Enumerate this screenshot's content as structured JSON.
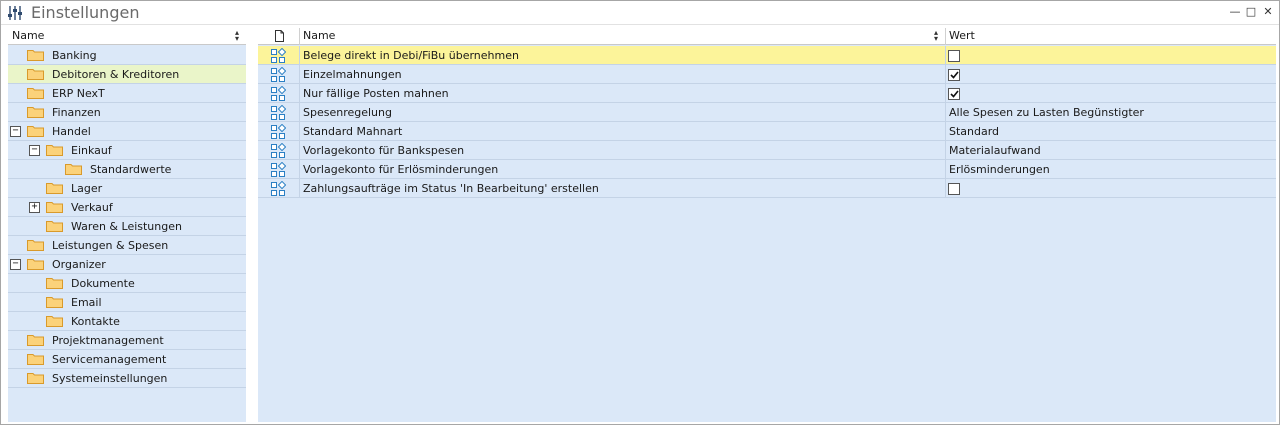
{
  "window": {
    "title": "Einstellungen",
    "icon": "sliders-icon",
    "controls": {
      "minimize": "—",
      "maximize": "□",
      "close": "✕"
    }
  },
  "tree": {
    "header": "Name",
    "items": [
      {
        "label": "Banking",
        "level": 0,
        "expander": "",
        "selected": false
      },
      {
        "label": "Debitoren & Kreditoren",
        "level": 0,
        "expander": "",
        "selected": true
      },
      {
        "label": "ERP NexT",
        "level": 0,
        "expander": "",
        "selected": false
      },
      {
        "label": "Finanzen",
        "level": 0,
        "expander": "",
        "selected": false
      },
      {
        "label": "Handel",
        "level": 0,
        "expander": "minus",
        "selected": false
      },
      {
        "label": "Einkauf",
        "level": 1,
        "expander": "minus",
        "selected": false
      },
      {
        "label": "Standardwerte",
        "level": 2,
        "expander": "",
        "selected": false
      },
      {
        "label": "Lager",
        "level": 1,
        "expander": "",
        "selected": false
      },
      {
        "label": "Verkauf",
        "level": 1,
        "expander": "plus",
        "selected": false
      },
      {
        "label": "Waren & Leistungen",
        "level": 1,
        "expander": "",
        "selected": false
      },
      {
        "label": "Leistungen & Spesen",
        "level": 0,
        "expander": "",
        "selected": false
      },
      {
        "label": "Organizer",
        "level": 0,
        "expander": "minus",
        "selected": false
      },
      {
        "label": "Dokumente",
        "level": 1,
        "expander": "",
        "selected": false
      },
      {
        "label": "Email",
        "level": 1,
        "expander": "",
        "selected": false
      },
      {
        "label": "Kontakte",
        "level": 1,
        "expander": "",
        "selected": false
      },
      {
        "label": "Projektmanagement",
        "level": 0,
        "expander": "",
        "selected": false
      },
      {
        "label": "Servicemanagement",
        "level": 0,
        "expander": "",
        "selected": false
      },
      {
        "label": "Systemeinstellungen",
        "level": 0,
        "expander": "",
        "selected": false
      }
    ]
  },
  "grid": {
    "columns": {
      "icon": "document-icon",
      "name": "Name",
      "value": "Wert"
    },
    "rows": [
      {
        "name": "Belege direkt in Debi/FiBu übernehmen",
        "type": "checkbox",
        "checked": false,
        "selected": true
      },
      {
        "name": "Einzelmahnungen",
        "type": "checkbox",
        "checked": true,
        "selected": false
      },
      {
        "name": "Nur fällige Posten mahnen",
        "type": "checkbox",
        "checked": true,
        "selected": false
      },
      {
        "name": "Spesenregelung",
        "type": "text",
        "value": "Alle Spesen zu Lasten Begünstigter",
        "selected": false
      },
      {
        "name": "Standard Mahnart",
        "type": "text",
        "value": "Standard",
        "selected": false
      },
      {
        "name": "Vorlagekonto für Bankspesen",
        "type": "text",
        "value": "Materialaufwand",
        "selected": false
      },
      {
        "name": "Vorlagekonto für Erlösminderungen",
        "type": "text",
        "value": "Erlösminderungen",
        "selected": false
      },
      {
        "name": "Zahlungsaufträge im Status 'In Bearbeitung' erstellen",
        "type": "checkbox",
        "checked": false,
        "selected": false
      }
    ]
  },
  "colors": {
    "pane_bg": "#dbe8f8",
    "tree_selected": "#eaf5c9",
    "grid_selected": "#fcf49a",
    "folder_fill": "#fbd27a",
    "folder_stroke": "#d99a2b",
    "row_icon": "#2a7fc4"
  }
}
